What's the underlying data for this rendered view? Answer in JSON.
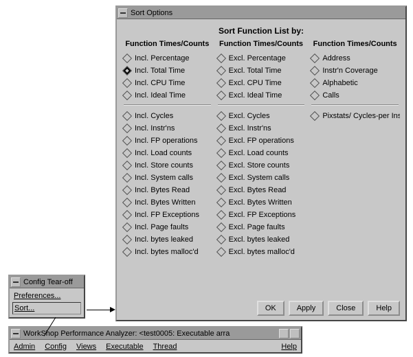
{
  "sort_dialog": {
    "title": "Sort Options",
    "header": "Sort Function List by:",
    "col_header1": "Function Times/Counts",
    "col_header2": "Function Times/Counts",
    "col_header3": "Function Times/Counts",
    "col1a": [
      "Incl. Percentage",
      "Incl. Total Time",
      "Incl. CPU Time",
      "Incl. Ideal Time"
    ],
    "col1a_selected_index": 1,
    "col1b": [
      "Incl. Cycles",
      "Incl. Instr'ns",
      "Incl. FP operations",
      "Incl. Load counts",
      "Incl. Store counts",
      "Incl. System calls",
      "Incl. Bytes Read",
      "Incl. Bytes Written",
      "Incl. FP Exceptions",
      "Incl. Page faults",
      "Incl. bytes leaked",
      "Incl. bytes malloc'd"
    ],
    "col2a": [
      "Excl. Percentage",
      "Excl. Total Time",
      "Excl. CPU Time",
      "Excl. Ideal Time"
    ],
    "col2b": [
      "Excl. Cycles",
      "Excl. Instr'ns",
      "Excl. FP operations",
      "Excl. Load counts",
      "Excl. Store counts",
      "Excl. System calls",
      "Excl. Bytes Read",
      "Excl. Bytes Written",
      "Excl. FP Exceptions",
      "Excl. Page faults",
      "Excl. bytes leaked",
      "Excl. bytes malloc'd"
    ],
    "col3a": [
      "Address",
      "Instr'n Coverage",
      "Alphabetic",
      "Calls"
    ],
    "col3b": [
      "Pixstats/ Cycles-per Instr'n"
    ],
    "buttons": {
      "ok": "OK",
      "apply": "Apply",
      "close": "Close",
      "help": "Help"
    }
  },
  "tearoff": {
    "title": "Config Tear-off",
    "items": [
      "Preferences...",
      "Sort..."
    ],
    "selected_index": 1
  },
  "analyzer": {
    "title": "WorkShop Performance Analyzer: <test0005: Executable arra",
    "menus": [
      "Admin",
      "Config",
      "Views",
      "Executable",
      "Thread"
    ],
    "help": "Help"
  }
}
